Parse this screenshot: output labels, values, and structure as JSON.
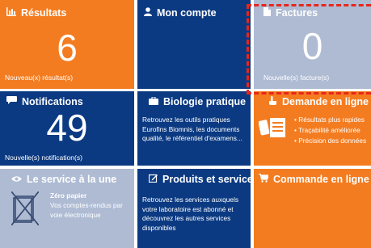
{
  "tiles": {
    "resultats": {
      "title": "Résultats",
      "count": "6",
      "footer": "Nouveau(x) résultat(s)",
      "icon": "bar-chart-icon"
    },
    "mon_compte": {
      "title": "Mon compte",
      "icon": "user-icon"
    },
    "factures": {
      "title": "Factures",
      "count": "0",
      "footer": "Nouvelle(s) facture(s)",
      "icon": "document-icon"
    },
    "notifications": {
      "title": "Notifications",
      "count": "49",
      "footer": "Nouvelle(s) notification(s)",
      "icon": "chat-icon"
    },
    "biologie": {
      "title": "Biologie pratique",
      "description": "Retrouvez les outils pratiques Eurofins Biomnis, les documents qualité, le référentiel d'examens...",
      "icon": "briefcase-icon"
    },
    "demande": {
      "title": "Demande en ligne",
      "bullets": [
        "Résultats plus rapides",
        "Traçabilité améliorée",
        "Précision des données"
      ],
      "icon": "phone-form-icon"
    },
    "service": {
      "title": "Le service à la une",
      "subtitle": "Zéro papier",
      "description": "Vos comptes-rendus par voie électronique",
      "icon": "eye-icon"
    },
    "produits": {
      "title": "Produits et services",
      "description": "Retrouvez les services auxquels votre laboratoire est abonné et découvrez les autres services disponibles",
      "icon": "edit-icon"
    },
    "commande": {
      "title": "Commande en ligne",
      "icon": "cart-icon"
    }
  },
  "colors": {
    "orange": "#f47c20",
    "navy": "#0b3a82",
    "light": "#aebbd3",
    "highlight": "#e8261c"
  }
}
